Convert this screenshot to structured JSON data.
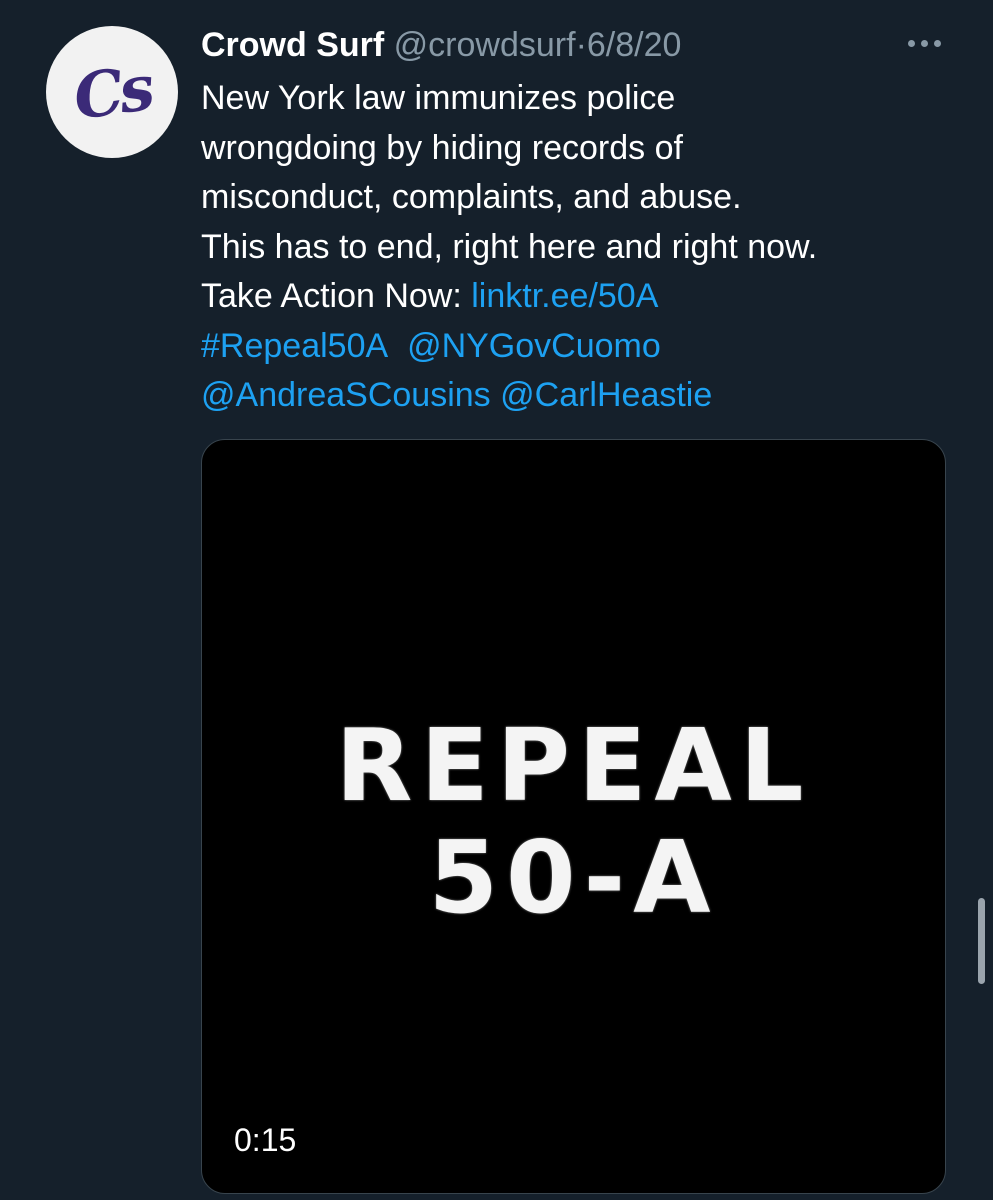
{
  "tweet": {
    "author_name": "Crowd Surf",
    "author_handle": "@crowdsurf",
    "separator": "·",
    "date": "6/8/20",
    "avatar_text": "Cs",
    "text_lines": [
      "New York law immunizes police",
      "wrongdoing by hiding records of",
      "misconduct, complaints, and abuse.",
      "This has to end, right here and right now."
    ],
    "take_action_label": "Take Action Now:",
    "take_action_link": "linktr.ee/50A",
    "hashtag": "#Repeal50A",
    "mentions": [
      "@NYGovCuomo",
      "@AndreaSCousins",
      "@CarlHeastie"
    ]
  },
  "media": {
    "title_line1": "REPEAL",
    "title_line2": "50-A",
    "duration": "0:15"
  },
  "colors": {
    "background": "#15202b",
    "link": "#1da1f2",
    "secondary_text": "#8899a6"
  },
  "icons": {
    "more": "more-horizontal-icon"
  }
}
